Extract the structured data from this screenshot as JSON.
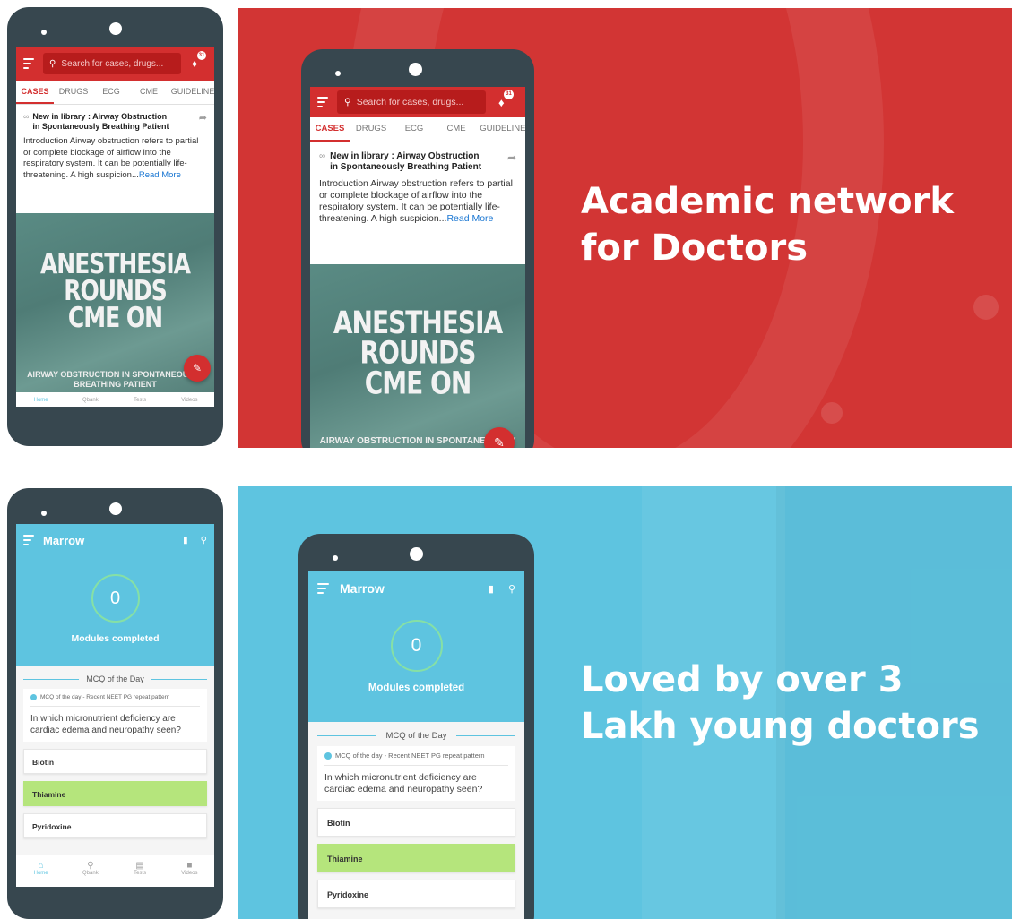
{
  "banners": {
    "red": {
      "title_line1": "Academic network",
      "title_line2": "for Doctors",
      "bg_color": "#d23534"
    },
    "blue": {
      "title_line1": "Loved by over 3",
      "title_line2": "Lakh young doctors",
      "bg_color": "#5ec4e0"
    }
  },
  "cases_app": {
    "search_placeholder": "Search for cases, drugs...",
    "notification_count": "31",
    "tabs": [
      "CASES",
      "DRUGS",
      "ECG",
      "CME",
      "GUIDELINES"
    ],
    "active_tab": "CASES",
    "post": {
      "title": "New in library : Airway Obstruction in Spontaneously Breathing Patient",
      "body": "Introduction Airway obstruction refers to partial or complete blockage of airflow into the respiratory system. It can be potentially life-threatening. A high suspicion...",
      "read_more": "Read More"
    },
    "poster": {
      "heading_line1": "ANESTHESIA",
      "heading_line2": "ROUNDS",
      "heading_line3": "CME ON",
      "subtitle_line1": "AIRWAY OBSTRUCTION IN SPONTANEOUSLY",
      "subtitle_line2": "BREATHING PATIENT"
    },
    "bottom_nav": [
      "Home",
      "Qbank",
      "Tests",
      "Videos"
    ],
    "accent_color": "#d32f2f"
  },
  "marrow_app": {
    "app_title": "Marrow",
    "modules_completed_count": "0",
    "modules_completed_label": "Modules completed",
    "mcq_section_title": "MCQ of the Day",
    "mcq_tag": "MCQ of the day - Recent NEET PG repeat pattern",
    "question": "In which micronutrient deficiency are cardiac edema and neuropathy seen?",
    "options": [
      "Biotin",
      "Thiamine",
      "Pyridoxine"
    ],
    "selected_option": "Thiamine",
    "bottom_nav": [
      "Home",
      "Qbank",
      "Tests",
      "Videos"
    ],
    "accent_color": "#5ec4e0",
    "selected_color": "#b5e57c"
  }
}
